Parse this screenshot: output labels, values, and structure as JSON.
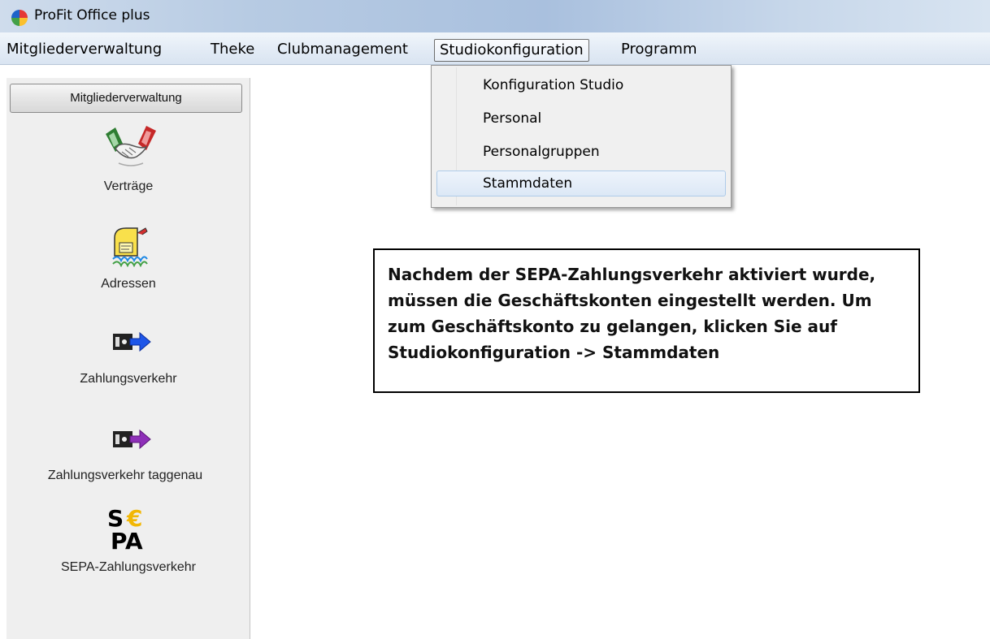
{
  "window": {
    "title": "ProFit Office plus",
    "icon": "color-wheel-icon"
  },
  "menubar": {
    "items": [
      {
        "label": "Mitgliederverwaltung"
      },
      {
        "label": "Theke"
      },
      {
        "label": "Clubmanagement"
      },
      {
        "label": "Studiokonfiguration",
        "active": true
      },
      {
        "label": "Programm"
      }
    ]
  },
  "dropdown": {
    "items": [
      {
        "label": "Konfiguration Studio"
      },
      {
        "label": "Personal"
      },
      {
        "label": "Personalgruppen"
      },
      {
        "label": "Stammdaten",
        "highlighted": true
      }
    ]
  },
  "sidebar": {
    "header": "Mitgliederverwaltung",
    "items": [
      {
        "label": "Verträge",
        "icon": "handshake-icon"
      },
      {
        "label": "Adressen",
        "icon": "mailbox-icon"
      },
      {
        "label": "Zahlungsverkehr",
        "icon": "payment-transfer-icon"
      },
      {
        "label": "Zahlungsverkehr taggenau",
        "icon": "payment-transfer-daily-icon"
      },
      {
        "label": "SEPA-Zahlungsverkehr",
        "icon": "sepa-logo-icon"
      }
    ]
  },
  "note": {
    "text": "Nachdem der SEPA-Zahlungsverkehr aktiviert wurde, müssen die Geschäftskonten eingestellt werden. Um zum Geschäftskonto zu gelangen, klicken Sie auf Studiokonfiguration -> Stammdaten"
  },
  "colors": {
    "titlebar": "#b7cbe3",
    "menubar": "#e4ecf6",
    "sidebar": "#efefef",
    "dropdown": "#f0f0f0",
    "highlight": "#dce8f6"
  },
  "sepa_logo": {
    "s": "S",
    "euro": "€",
    "pa": "PA"
  }
}
